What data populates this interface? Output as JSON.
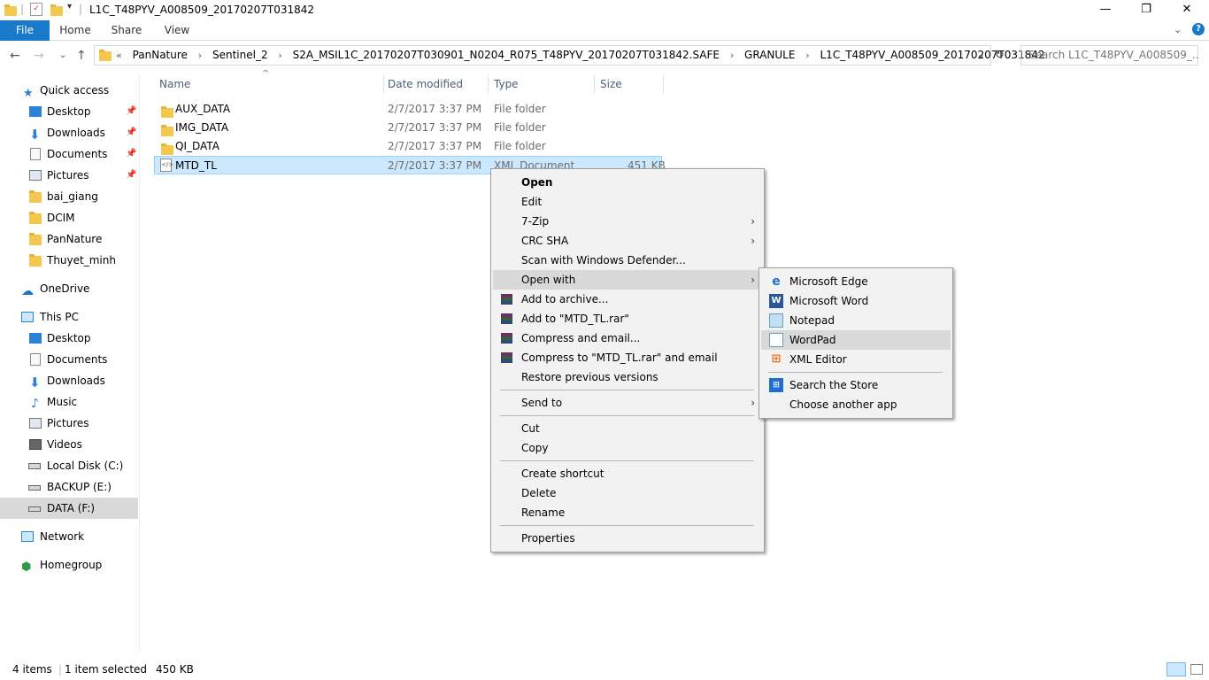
{
  "window": {
    "title": "L1C_T48PYV_A008509_20170207T031842",
    "minimize": "—",
    "maximize": "❐",
    "close": "✕"
  },
  "ribbon": {
    "file": "File",
    "home": "Home",
    "share": "Share",
    "view": "View"
  },
  "address": {
    "overflow": "«",
    "crumbs": [
      "PanNature",
      "Sentinel_2",
      "S2A_MSIL1C_20170207T030901_N0204_R075_T48PYV_20170207T031842.SAFE",
      "GRANULE",
      "L1C_T48PYV_A008509_20170207T031842"
    ],
    "search_placeholder": "Search L1C_T48PYV_A008509_..."
  },
  "nav": {
    "quick_access": "Quick access",
    "qa_items": [
      "Desktop",
      "Downloads",
      "Documents",
      "Pictures",
      "bai_giang",
      "DCIM",
      "PanNature",
      "Thuyet_minh"
    ],
    "onedrive": "OneDrive",
    "this_pc": "This PC",
    "pc_items": [
      "Desktop",
      "Documents",
      "Downloads",
      "Music",
      "Pictures",
      "Videos",
      "Local Disk (C:)",
      "BACKUP (E:)",
      "DATA (F:)"
    ],
    "network": "Network",
    "homegroup": "Homegroup"
  },
  "columns": {
    "name": "Name",
    "date": "Date modified",
    "type": "Type",
    "size": "Size"
  },
  "files": [
    {
      "name": "AUX_DATA",
      "date": "2/7/2017 3:37 PM",
      "type": "File folder",
      "size": ""
    },
    {
      "name": "IMG_DATA",
      "date": "2/7/2017 3:37 PM",
      "type": "File folder",
      "size": ""
    },
    {
      "name": "QI_DATA",
      "date": "2/7/2017 3:37 PM",
      "type": "File folder",
      "size": ""
    },
    {
      "name": "MTD_TL",
      "date": "2/7/2017 3:37 PM",
      "type": "XML Document",
      "size": "451 KB"
    }
  ],
  "context_menu": {
    "open": "Open",
    "edit": "Edit",
    "zip": "7-Zip",
    "crc": "CRC SHA",
    "scan": "Scan with Windows Defender...",
    "open_with": "Open with",
    "add_archive": "Add to archive...",
    "add_rar": "Add to \"MTD_TL.rar\"",
    "compress_email": "Compress and email...",
    "compress_rar_email": "Compress to \"MTD_TL.rar\" and email",
    "restore": "Restore previous versions",
    "send_to": "Send to",
    "cut": "Cut",
    "copy": "Copy",
    "create_shortcut": "Create shortcut",
    "delete": "Delete",
    "rename": "Rename",
    "properties": "Properties"
  },
  "open_with_menu": {
    "edge": "Microsoft Edge",
    "word": "Microsoft Word",
    "notepad": "Notepad",
    "wordpad": "WordPad",
    "xml_editor": "XML Editor",
    "store": "Search the Store",
    "another": "Choose another app"
  },
  "status": {
    "items": "4 items",
    "selected": "1 item selected",
    "size": "450 KB"
  },
  "colors": {
    "accent": "#1979ca",
    "selection": "#cce8ff",
    "folder": "#f4c84f"
  }
}
